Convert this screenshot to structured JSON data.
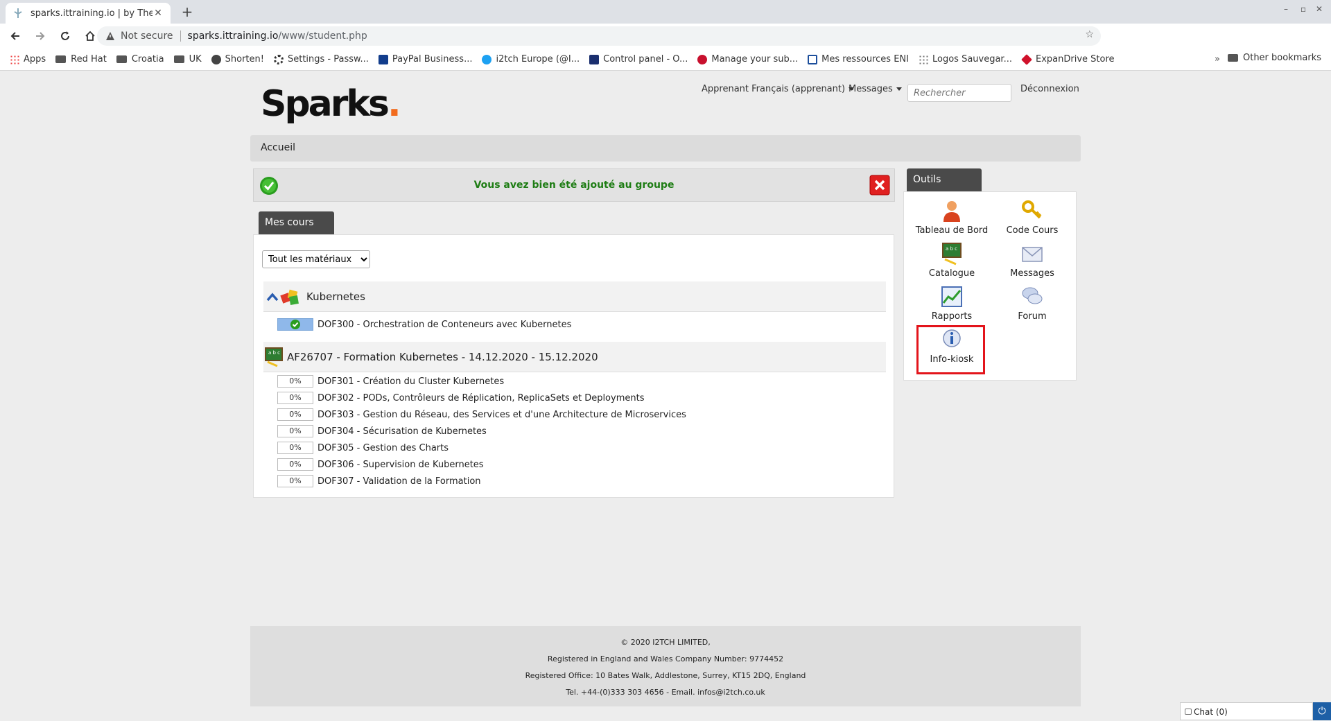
{
  "browser": {
    "tab_title": "sparks.ittraining.io | by The IT",
    "not_secure": "Not secure",
    "url_host": "sparks.ittraining.io",
    "url_path": "/www/student.php",
    "bookmarks": [
      "Apps",
      "Red Hat",
      "Croatia",
      "UK",
      "Shorten!",
      "Settings - Passw...",
      "PayPal Business...",
      "i2tch Europe (@I...",
      "Control panel - O...",
      "Manage your sub...",
      "Mes ressources ENI",
      "Logos Sauvegar...",
      "ExpanDrive Store"
    ],
    "more": "»",
    "other_bookmarks": "Other bookmarks"
  },
  "site": {
    "logo": "Sparks",
    "logo_dot": ".",
    "user_menu": "Apprenant Français (apprenant)",
    "messages_menu": "Messages",
    "search_placeholder": "Rechercher",
    "logout": "Déconnexion"
  },
  "breadcrumb": "Accueil",
  "alert": "Vous avez bien été ajouté au groupe",
  "courses_tab": "Mes cours",
  "filter": {
    "selected": "Tout les matériaux"
  },
  "category": {
    "name": "Kubernetes",
    "items": [
      {
        "progress": "",
        "label": "DOF300 - Orchestration de Conteneurs avec Kubernetes"
      }
    ]
  },
  "session": {
    "name": "AF26707 - Formation Kubernetes - 14.12.2020 - 15.12.2020",
    "items": [
      {
        "progress": "0%",
        "label": "DOF301 - Création du Cluster Kubernetes"
      },
      {
        "progress": "0%",
        "label": "DOF302 - PODs, Contrôleurs de Réplication, ReplicaSets et Deployments"
      },
      {
        "progress": "0%",
        "label": "DOF303 - Gestion du Réseau, des Services et d'une Architecture de Microservices"
      },
      {
        "progress": "0%",
        "label": "DOF304 - Sécurisation de Kubernetes"
      },
      {
        "progress": "0%",
        "label": "DOF305 - Gestion des Charts"
      },
      {
        "progress": "0%",
        "label": "DOF306 - Supervision de Kubernetes"
      },
      {
        "progress": "0%",
        "label": "DOF307 - Validation de la Formation"
      }
    ]
  },
  "tools": {
    "title": "Outils",
    "items": [
      "Tableau de Bord",
      "Code Cours",
      "Catalogue",
      "Messages",
      "Rapports",
      "Forum",
      "Info-kiosk"
    ]
  },
  "footer": {
    "line1": "© 2020 I2TCH LIMITED,",
    "line2": "Registered in England and Wales Company Number: 9774452",
    "line3": "Registered Office: 10 Bates Walk, Addlestone, Surrey, KT15 2DQ, England",
    "line4": "Tel. +44-(0)333 303 4656 - Email. infos@i2tch.co.uk"
  },
  "chat": "Chat (0)"
}
